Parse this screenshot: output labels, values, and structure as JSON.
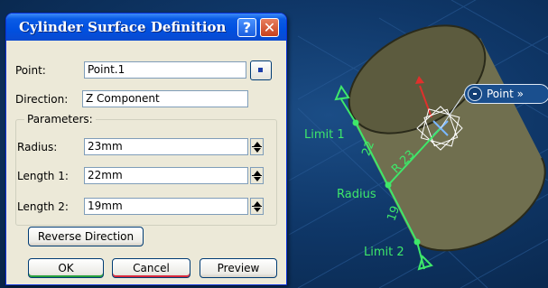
{
  "dialog": {
    "title": "Cylinder Surface Definition",
    "help_glyph": "?",
    "close_glyph": "✕",
    "point": {
      "label": "Point:",
      "value": "Point.1"
    },
    "direction": {
      "label": "Direction:",
      "value": "Z Component"
    },
    "parameters": {
      "legend": "Parameters:",
      "radius": {
        "label": "Radius:",
        "value": "23mm"
      },
      "length1": {
        "label": "Length 1:",
        "value": "22mm"
      },
      "length2": {
        "label": "Length 2:",
        "value": "19mm"
      }
    },
    "reverse_direction_label": "Reverse Direction",
    "ok_label": "OK",
    "cancel_label": "Cancel",
    "preview_label": "Preview"
  },
  "viewport": {
    "limit1_label": "Limit 1",
    "limit2_label": "Limit 2",
    "radius_label": "Radius",
    "dim_length1": "22",
    "dim_radius": "R 23",
    "dim_length2": "19",
    "point_badge_label": "Point",
    "point_badge_arrow": "»"
  },
  "colors": {
    "titlebar": "#0a5ce6",
    "dialog_bg": "#ece9d8",
    "cylinder": "#707050",
    "annotation_green": "#3ee86a",
    "background": "#0f3768"
  }
}
